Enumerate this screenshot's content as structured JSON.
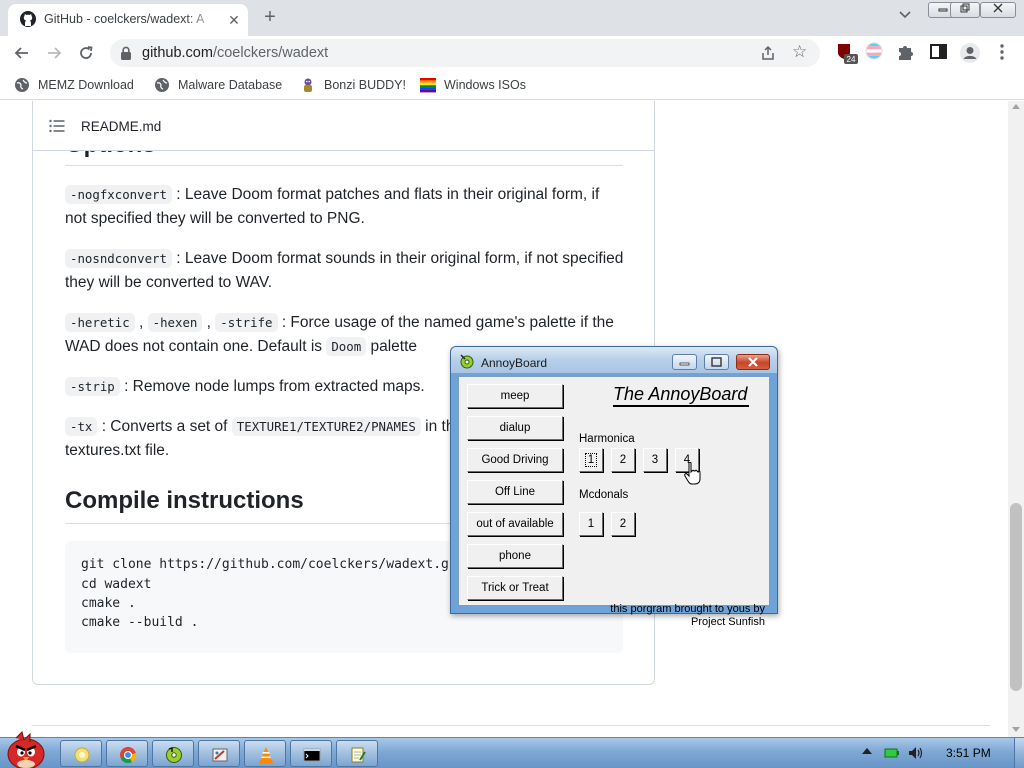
{
  "browser": {
    "tab_title": "GitHub - coelckers/wadext: A",
    "new_tab_symbol": "+",
    "url_host": "github.com",
    "url_path": "/coelckers/wadext",
    "extension_badge": "24",
    "bookmarks": [
      {
        "label": "MEMZ Download",
        "icon": "globe-icon"
      },
      {
        "label": "Malware Database",
        "icon": "globe-icon"
      },
      {
        "label": "Bonzi BUDDY!",
        "icon": "bonzi-icon"
      },
      {
        "label": "Windows ISOs",
        "icon": "rainbow-flag-icon"
      }
    ]
  },
  "readme": {
    "file_name": "README.md",
    "options_heading": "Options",
    "options": [
      {
        "codes": [
          "-nogfxconvert"
        ],
        "text": " : Leave Doom format patches and flats in their original form, if not specified they will be converted to PNG."
      },
      {
        "codes": [
          "-nosndconvert"
        ],
        "text": " : Leave Doom format sounds in their original form, if not specified they will be converted to WAV."
      },
      {
        "codes": [
          "-heretic",
          "-hexen",
          "-strife"
        ],
        "text_a": " , ",
        "text_b": " , ",
        "text": " : Force usage of the named game's palette if the WAD does not contain one. Default is ",
        "code_inline": "Doom",
        "text_end": " palette"
      },
      {
        "codes": [
          "-strip"
        ],
        "text": " : Remove node lumps from extracted maps."
      },
      {
        "codes": [
          "-tx"
        ],
        "text": " : Converts a set of ",
        "code_inline": "TEXTURE1/TEXTURE2/PNAMES",
        "text_end": " in the",
        "text_wrap": "textures.txt file."
      }
    ],
    "compile_heading": "Compile instructions",
    "code_lines": [
      "git clone https://github.com/coelckers/wadext.git",
      "cd wadext",
      "cmake .",
      "cmake --build ."
    ]
  },
  "annoyboard": {
    "window_title": "AnnoyBoard",
    "heading": "The AnnoyBoard",
    "left_buttons": [
      "meep",
      "dialup",
      "Good Driving",
      "Off Line",
      "out of available",
      "phone",
      "Trick or Treat"
    ],
    "harmonica_label": "Harmonica",
    "harmonica_buttons": [
      "1",
      "2",
      "3",
      "4"
    ],
    "mcdonals_label": "Mcdonals",
    "mcdonals_buttons": [
      "1",
      "2"
    ],
    "credit_line1": "this porgram brought to yous by",
    "credit_line2": "Project Sunfish"
  },
  "taskbar": {
    "clock": "3:51 PM",
    "pinned": [
      "explorer-icon",
      "chrome-icon",
      "cd-music-icon",
      "paint-icon",
      "vlc-icon",
      "cmd-icon",
      "notepad-icon"
    ]
  },
  "colors": {
    "github_text": "#1f2328",
    "code_bg": "#eff1f3",
    "window_frame": "#6da3d6",
    "taskbar": "#7fa8d4"
  }
}
